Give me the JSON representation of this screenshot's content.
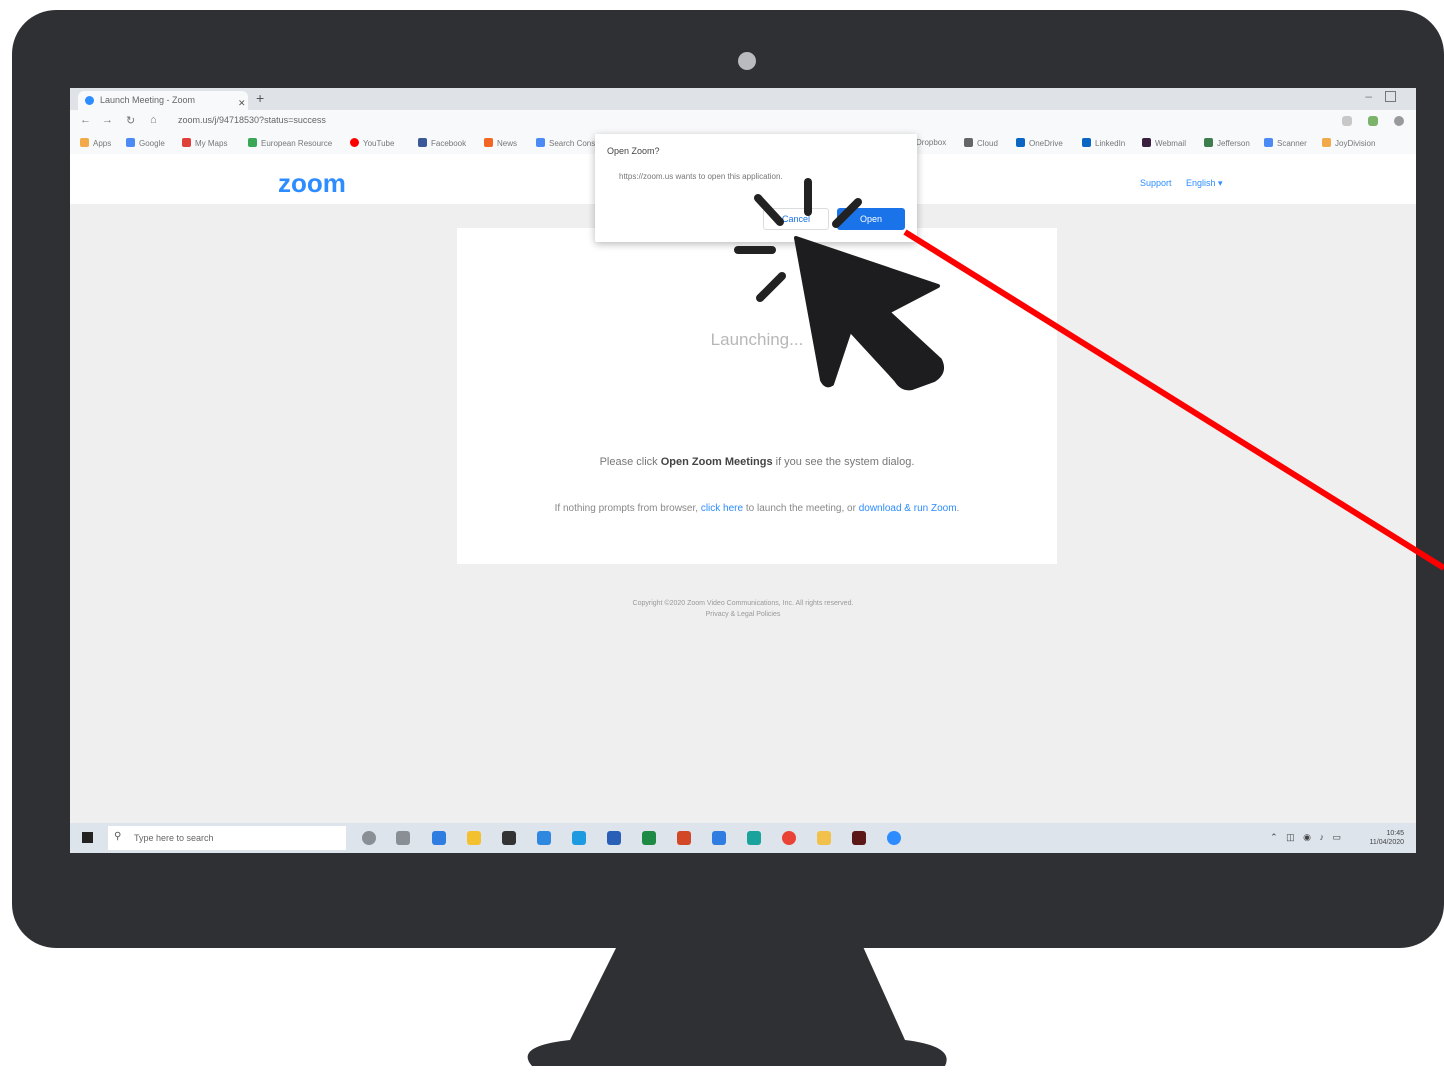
{
  "browser": {
    "tab_title": "Launch Meeting - Zoom",
    "url": "zoom.us/j/94718530?status=success",
    "bookmarks": [
      "Apps",
      "Google",
      "My Maps",
      "European Resource",
      "YouTube",
      "Facebook",
      "News",
      "Search Console",
      "Dropbox",
      "Cloud",
      "OneDrive",
      "LinkedIn",
      "Webmail",
      "Jefferson",
      "Scanner",
      "JoyDivision"
    ]
  },
  "zoom_page": {
    "logo": "zoom",
    "support_link": "Support",
    "language_link": "English ▾",
    "launching_text": "Launching...",
    "instruction_pre": "Please click ",
    "instruction_bold": "Open Zoom Meetings",
    "instruction_post": " if you see the system dialog.",
    "links_pre": "If nothing prompts from browser, ",
    "click_here": "click here",
    "links_mid": " to launch the meeting, or ",
    "download_link": "download & run Zoom",
    "links_post": ".",
    "copyright_line1": "Copyright ©2020 Zoom Video Communications, Inc. All rights reserved.",
    "copyright_line2": "Privacy & Legal Policies"
  },
  "dialog": {
    "title": "Open Zoom?",
    "message": "https://zoom.us wants to open this application.",
    "cancel_label": "Cancel",
    "open_label": "Open"
  },
  "taskbar": {
    "search_placeholder": "Type here to search",
    "time": "10:45",
    "date": "11/04/2020"
  },
  "colors": {
    "zoom_blue": "#2d8cff",
    "arrow_red": "#ff0000",
    "monitor": "#2f3033"
  },
  "icons": [
    "camera-icon",
    "mouse-pointer-icon",
    "click-burst-icon",
    "red-arrow-line",
    "windows-start-icon",
    "search-icon"
  ]
}
